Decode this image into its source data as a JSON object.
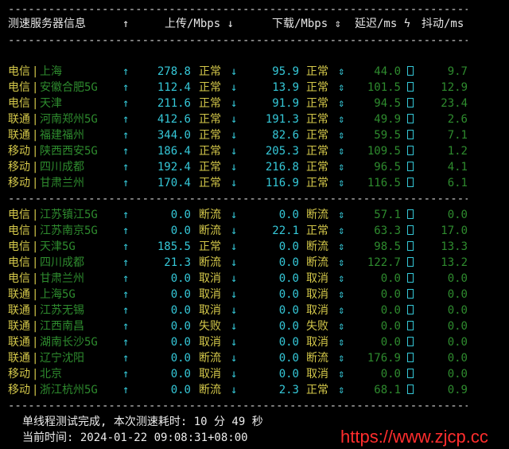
{
  "header": {
    "server": "测速服务器信息",
    "up_arrow": "↑",
    "upload": "上传/Mbps ↓",
    "download": "下载/Mbps ⇕",
    "latency": "延迟/ms ϟ",
    "jitter": "抖动/ms"
  },
  "separator": "----------------------------------------------------------------------------------------------------",
  "group1": [
    {
      "isp": "电信",
      "loc": "上海",
      "up": "278.8",
      "up_status": "正常",
      "down": "95.9",
      "down_status": "正常",
      "lat": "44.0",
      "jit": "9.7"
    },
    {
      "isp": "电信",
      "loc": "安徽合肥5G",
      "up": "112.4",
      "up_status": "正常",
      "down": "13.9",
      "down_status": "正常",
      "lat": "101.5",
      "jit": "12.9"
    },
    {
      "isp": "电信",
      "loc": "天津",
      "up": "211.6",
      "up_status": "正常",
      "down": "91.9",
      "down_status": "正常",
      "lat": "94.5",
      "jit": "23.4"
    },
    {
      "isp": "联通",
      "loc": "河南郑州5G",
      "up": "412.6",
      "up_status": "正常",
      "down": "191.3",
      "down_status": "正常",
      "lat": "49.9",
      "jit": "2.6"
    },
    {
      "isp": "联通",
      "loc": "福建福州",
      "up": "344.0",
      "up_status": "正常",
      "down": "82.6",
      "down_status": "正常",
      "lat": "59.5",
      "jit": "7.1"
    },
    {
      "isp": "移动",
      "loc": "陕西西安5G",
      "up": "186.4",
      "up_status": "正常",
      "down": "205.3",
      "down_status": "正常",
      "lat": "109.5",
      "jit": "1.2"
    },
    {
      "isp": "移动",
      "loc": "四川成都",
      "up": "192.4",
      "up_status": "正常",
      "down": "216.8",
      "down_status": "正常",
      "lat": "96.5",
      "jit": "4.1"
    },
    {
      "isp": "移动",
      "loc": "甘肃兰州",
      "up": "170.4",
      "up_status": "正常",
      "down": "116.9",
      "down_status": "正常",
      "lat": "116.5",
      "jit": "6.1"
    }
  ],
  "group2": [
    {
      "isp": "电信",
      "loc": "江苏镇江5G",
      "up": "0.0",
      "up_status": "断流",
      "down": "0.0",
      "down_status": "断流",
      "lat": "57.1",
      "jit": "0.0"
    },
    {
      "isp": "电信",
      "loc": "江苏南京5G",
      "up": "0.0",
      "up_status": "断流",
      "down": "22.1",
      "down_status": "正常",
      "lat": "63.3",
      "jit": "17.0"
    },
    {
      "isp": "电信",
      "loc": "天津5G",
      "up": "185.5",
      "up_status": "正常",
      "down": "0.0",
      "down_status": "断流",
      "lat": "98.5",
      "jit": "13.3"
    },
    {
      "isp": "电信",
      "loc": "四川成都",
      "up": "21.3",
      "up_status": "断流",
      "down": "0.0",
      "down_status": "断流",
      "lat": "122.7",
      "jit": "13.2"
    },
    {
      "isp": "电信",
      "loc": "甘肃兰州",
      "up": "0.0",
      "up_status": "取消",
      "down": "0.0",
      "down_status": "取消",
      "lat": "0.0",
      "jit": "0.0"
    },
    {
      "isp": "联通",
      "loc": "上海5G",
      "up": "0.0",
      "up_status": "取消",
      "down": "0.0",
      "down_status": "取消",
      "lat": "0.0",
      "jit": "0.0"
    },
    {
      "isp": "联通",
      "loc": "江苏无锡",
      "up": "0.0",
      "up_status": "取消",
      "down": "0.0",
      "down_status": "取消",
      "lat": "0.0",
      "jit": "0.0"
    },
    {
      "isp": "联通",
      "loc": "江西南昌",
      "up": "0.0",
      "up_status": "失败",
      "down": "0.0",
      "down_status": "失败",
      "lat": "0.0",
      "jit": "0.0"
    },
    {
      "isp": "联通",
      "loc": "湖南长沙5G",
      "up": "0.0",
      "up_status": "取消",
      "down": "0.0",
      "down_status": "取消",
      "lat": "0.0",
      "jit": "0.0"
    },
    {
      "isp": "联通",
      "loc": "辽宁沈阳",
      "up": "0.0",
      "up_status": "断流",
      "down": "0.0",
      "down_status": "断流",
      "lat": "176.9",
      "jit": "0.0"
    },
    {
      "isp": "移动",
      "loc": "北京",
      "up": "0.0",
      "up_status": "取消",
      "down": "0.0",
      "down_status": "取消",
      "lat": "0.0",
      "jit": "0.0"
    },
    {
      "isp": "移动",
      "loc": "浙江杭州5G",
      "up": "0.0",
      "up_status": "断流",
      "down": "2.3",
      "down_status": "正常",
      "lat": "68.1",
      "jit": "0.9"
    }
  ],
  "footer": {
    "done": "单线程测试完成, 本次测速耗时: 10 分 49 秒",
    "time": "当前时间: 2024-01-22 09:08:31+08:00"
  },
  "watermark": "https://www.zjcp.cc",
  "glyphs": {
    "up": "↑",
    "down": "↓",
    "updown": "⇕",
    "bar": "|"
  },
  "colors": {
    "background": "#000000",
    "isp": "#d4c84a",
    "location": "#2e8b2e",
    "value": "#35c8d8",
    "status": "#d4c84a",
    "latency": "#2e8b2e",
    "watermark": "#ff2d2d"
  }
}
